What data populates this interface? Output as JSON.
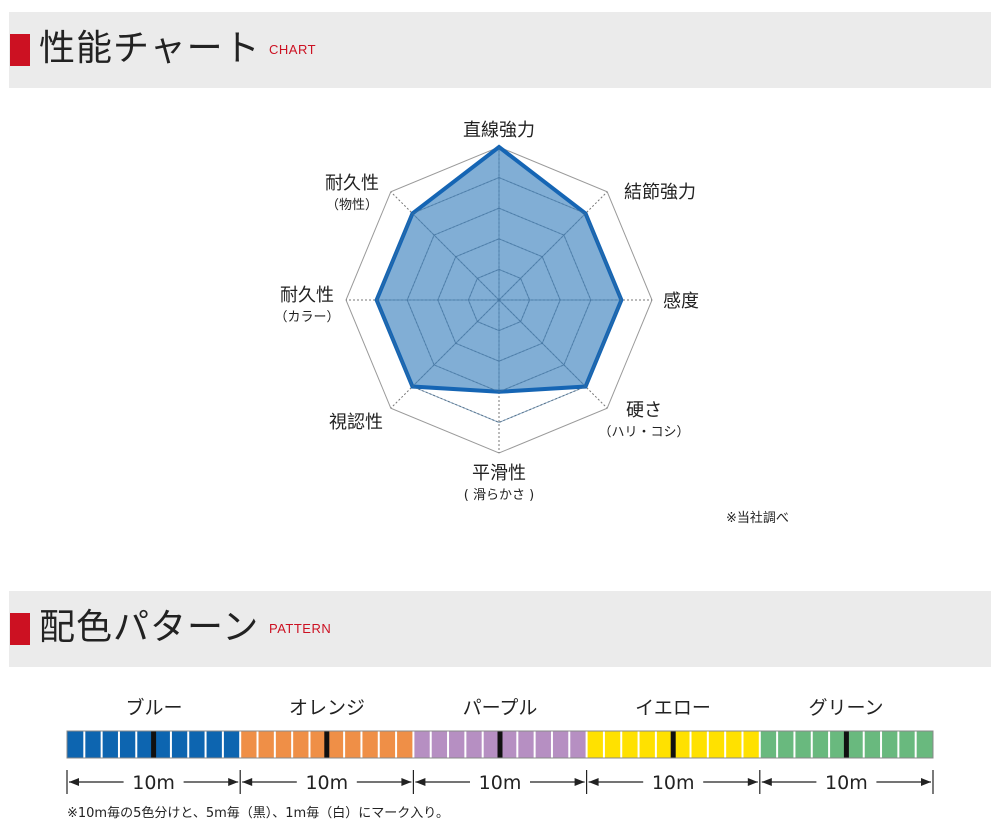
{
  "sections": {
    "chart": {
      "title": "性能チャート",
      "subtitle": "CHART"
    },
    "pattern": {
      "title": "配色パターン",
      "subtitle": "PATTERN"
    }
  },
  "colors": {
    "accent_red": "#cc1122",
    "series_fill": "#5d97c9",
    "series_stroke": "#1565b4",
    "grid": "#888888"
  },
  "chart_data": {
    "type": "radar",
    "axes": [
      {
        "label": "直線強力",
        "sublabel": ""
      },
      {
        "label": "結節強力",
        "sublabel": ""
      },
      {
        "label": "感度",
        "sublabel": ""
      },
      {
        "label": "硬さ",
        "sublabel": "（ハリ・コシ）"
      },
      {
        "label": "平滑性",
        "sublabel": "( 滑らかさ )"
      },
      {
        "label": "視認性",
        "sublabel": ""
      },
      {
        "label": "耐久性",
        "sublabel": "（カラー）"
      },
      {
        "label": "耐久性",
        "sublabel": "（物性）"
      }
    ],
    "levels": 5,
    "max": 5,
    "series": [
      {
        "values": [
          5,
          4,
          4,
          4,
          3,
          4,
          4,
          4
        ]
      }
    ],
    "note": "※当社調べ"
  },
  "pattern": {
    "segments": [
      {
        "name": "ブルー",
        "color": "#0d65b0",
        "length": "10m"
      },
      {
        "name": "オレンジ",
        "color": "#ef8f47",
        "length": "10m"
      },
      {
        "name": "パープル",
        "color": "#b68fc2",
        "length": "10m"
      },
      {
        "name": "イエロー",
        "color": "#ffe100",
        "length": "10m"
      },
      {
        "name": "グリーン",
        "color": "#69b97e",
        "length": "10m"
      }
    ],
    "marks_per_segment": 10,
    "black_mark_index": 5,
    "note": "※10m毎の5色分けと、5m毎（黒）、1m毎（白）にマーク入り。"
  }
}
